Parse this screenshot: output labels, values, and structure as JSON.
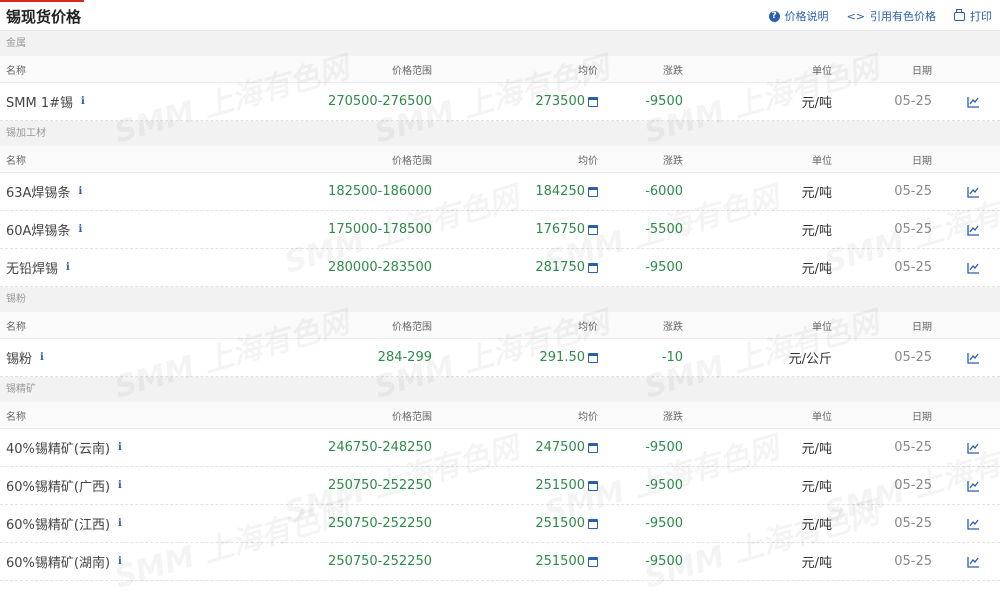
{
  "header": {
    "title": "锡现货价格",
    "actions": [
      {
        "label": "价格说明",
        "icon": "question-circle-icon"
      },
      {
        "label": "引用有色价格",
        "icon": "code-brackets-icon"
      },
      {
        "label": "打印",
        "icon": "print-icon"
      }
    ]
  },
  "columns": {
    "name": "名称",
    "range": "价格范围",
    "avg": "均价",
    "change": "涨跌",
    "unit": "单位",
    "date": "日期"
  },
  "watermark": "SMM 上海有色网",
  "accent_color": "#d9281f",
  "price_color": "#2e8b4a",
  "link_color": "#2a5fb0",
  "sections": [
    {
      "title": "金属",
      "rows": [
        {
          "name": "SMM 1#锡",
          "range": "270500-276500",
          "avg": "273500",
          "change": "-9500",
          "unit": "元/吨",
          "date": "05-25"
        }
      ]
    },
    {
      "title": "锡加工材",
      "rows": [
        {
          "name": "63A焊锡条",
          "range": "182500-186000",
          "avg": "184250",
          "change": "-6000",
          "unit": "元/吨",
          "date": "05-25"
        },
        {
          "name": "60A焊锡条",
          "range": "175000-178500",
          "avg": "176750",
          "change": "-5500",
          "unit": "元/吨",
          "date": "05-25"
        },
        {
          "name": "无铅焊锡",
          "range": "280000-283500",
          "avg": "281750",
          "change": "-9500",
          "unit": "元/吨",
          "date": "05-25"
        }
      ]
    },
    {
      "title": "锡粉",
      "rows": [
        {
          "name": "锡粉",
          "range": "284-299",
          "avg": "291.50",
          "change": "-10",
          "unit": "元/公斤",
          "date": "05-25"
        }
      ]
    },
    {
      "title": "锡精矿",
      "rows": [
        {
          "name": "40%锡精矿(云南)",
          "range": "246750-248250",
          "avg": "247500",
          "change": "-9500",
          "unit": "元/吨",
          "date": "05-25"
        },
        {
          "name": "60%锡精矿(广西)",
          "range": "250750-252250",
          "avg": "251500",
          "change": "-9500",
          "unit": "元/吨",
          "date": "05-25"
        },
        {
          "name": "60%锡精矿(江西)",
          "range": "250750-252250",
          "avg": "251500",
          "change": "-9500",
          "unit": "元/吨",
          "date": "05-25"
        },
        {
          "name": "60%锡精矿(湖南)",
          "range": "250750-252250",
          "avg": "251500",
          "change": "-9500",
          "unit": "元/吨",
          "date": "05-25"
        }
      ]
    }
  ]
}
